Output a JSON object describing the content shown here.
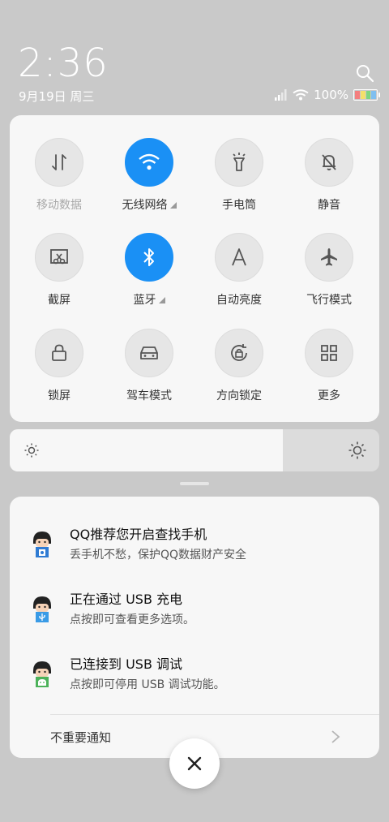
{
  "header": {
    "time": "2:36",
    "date": "9月19日 周三",
    "battery_text": "100%"
  },
  "quick_settings": [
    {
      "label": "移动数据",
      "icon": "mobile-data-icon",
      "active": false,
      "dim": true,
      "expand": false
    },
    {
      "label": "无线网络",
      "icon": "wifi-icon",
      "active": true,
      "dim": false,
      "expand": true
    },
    {
      "label": "手电筒",
      "icon": "flashlight-icon",
      "active": false,
      "dim": false,
      "expand": false
    },
    {
      "label": "静音",
      "icon": "mute-bell-icon",
      "active": false,
      "dim": false,
      "expand": false
    },
    {
      "label": "截屏",
      "icon": "screenshot-icon",
      "active": false,
      "dim": false,
      "expand": false
    },
    {
      "label": "蓝牙",
      "icon": "bluetooth-icon",
      "active": true,
      "dim": false,
      "expand": true
    },
    {
      "label": "自动亮度",
      "icon": "auto-brightness-icon",
      "active": false,
      "dim": false,
      "expand": false
    },
    {
      "label": "飞行模式",
      "icon": "airplane-icon",
      "active": false,
      "dim": false,
      "expand": false
    },
    {
      "label": "锁屏",
      "icon": "lock-icon",
      "active": false,
      "dim": false,
      "expand": false
    },
    {
      "label": "驾车模式",
      "icon": "car-icon",
      "active": false,
      "dim": false,
      "expand": false
    },
    {
      "label": "方向锁定",
      "icon": "rotation-lock-icon",
      "active": false,
      "dim": false,
      "expand": false
    },
    {
      "label": "更多",
      "icon": "grid-icon",
      "active": false,
      "dim": false,
      "expand": false
    }
  ],
  "brightness": {
    "level": 0.74
  },
  "notifications": [
    {
      "title": "QQ推荐您开启查找手机",
      "subtitle": "丢手机不愁，保护QQ数据财产安全",
      "icon": "qq-avatar-icon"
    },
    {
      "title": "正在通过 USB 充电",
      "subtitle": "点按即可查看更多选项。",
      "icon": "usb-charge-avatar-icon"
    },
    {
      "title": "已连接到 USB 调试",
      "subtitle": "点按即可停用 USB 调试功能。",
      "icon": "usb-debug-avatar-icon"
    }
  ],
  "unimportant_label": "不重要通知",
  "colors": {
    "accent": "#1a90f5",
    "panel": "#f7f7f7",
    "background": "#c9c9c9"
  }
}
